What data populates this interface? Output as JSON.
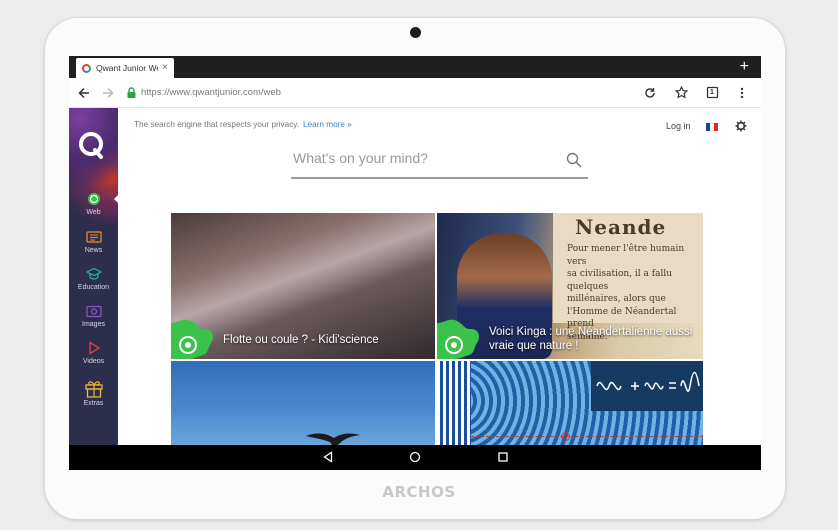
{
  "device": {
    "brand": "ARCHOS"
  },
  "browser": {
    "tab_title": "Qwant Junior We",
    "tab_close": "×",
    "new_tab": "+",
    "url": "https://www.qwantjunior.com/web",
    "tab_count": "1"
  },
  "page": {
    "tagline": "The search engine that respects your privacy.",
    "learn_more": "Learn more »",
    "login": "Log in",
    "search_placeholder": "What's on your mind?",
    "flag_colors": [
      "#1f3f9b",
      "#ffffff",
      "#e0252b"
    ]
  },
  "sidebar": {
    "items": [
      {
        "label": "Web",
        "icon": "web-icon",
        "color": "#3bc24a"
      },
      {
        "label": "News",
        "icon": "news-icon",
        "color": "#f08a24"
      },
      {
        "label": "Education",
        "icon": "education-icon",
        "color": "#2bb5a8"
      },
      {
        "label": "Images",
        "icon": "images-icon",
        "color": "#8a55c8"
      },
      {
        "label": "Videos",
        "icon": "videos-icon",
        "color": "#e23b4a"
      },
      {
        "label": "Extras",
        "icon": "gift-icon",
        "color": "#e6b73b"
      }
    ]
  },
  "results": [
    {
      "title": "Flotte ou coule ? - Kidi'science"
    },
    {
      "title": "Voici Kinga : une Néandertalienne aussi vraie que nature !",
      "sign_heading": "Neande",
      "sign_text": "Pour mener l'être humain vers\nsa civilisation, il a fallu quelques\nmillénaires, alors que\nl'Homme de Néandertal prend\nsemaine."
    },
    {
      "title": ""
    },
    {
      "title": ""
    }
  ],
  "accent": {
    "badge_green": "#3bc24a"
  }
}
